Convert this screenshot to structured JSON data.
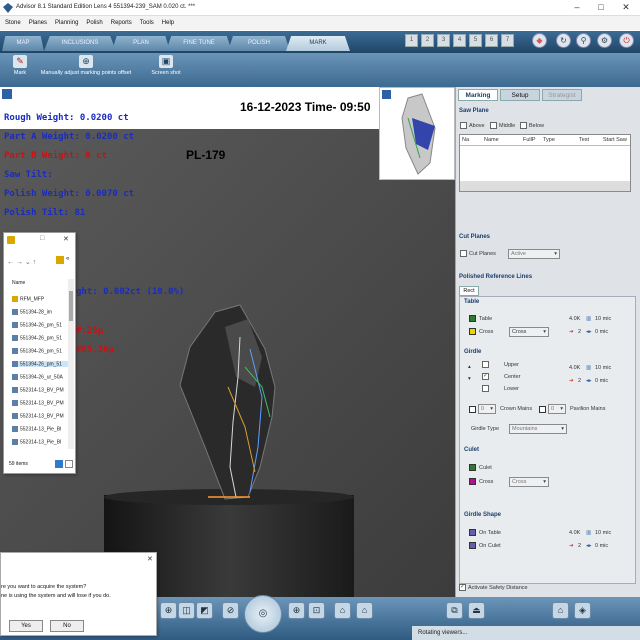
{
  "app": {
    "title": "Advisor 8.1 Standard Edition Lens 4    551394-239_SAM   0.020 ct. ***"
  },
  "menu": [
    "Stone",
    "Planes",
    "Planning",
    "Polish",
    "Reports",
    "Tools",
    "Help"
  ],
  "tabs": [
    {
      "label": "MAP"
    },
    {
      "label": "INCLUSIONS"
    },
    {
      "label": "PLAN"
    },
    {
      "label": "FINE TUNE"
    },
    {
      "label": "POLISH"
    },
    {
      "label": "MARK",
      "active": true
    }
  ],
  "stage_buttons": [
    "1",
    "2",
    "3",
    "4",
    "5",
    "6",
    "7"
  ],
  "toolbar": {
    "mark_label": "Mark",
    "adjust_label": "Manually adjust marking points offset",
    "screenshot_label": "Screen shot"
  },
  "viewer": {
    "datetime": "16-12-2023 Time- 09:50",
    "plabel": "PL-179",
    "lines": [
      {
        "text": "Rough Weight: 0.0200 ct",
        "color": "blue"
      },
      {
        "text": "Part A Weight: 0.0200 ct",
        "color": "blue"
      },
      {
        "text": "Part B Weight: 0 ct",
        "color": "red"
      },
      {
        "text": "Saw Tilt:",
        "color": "blue"
      },
      {
        "text": "Polish Weight: 0.0070 ct",
        "color": "blue"
      },
      {
        "text": "Polish Tilt: 81",
        "color": "blue"
      }
    ],
    "partial1": "ght: 0.002ct (10.0%)",
    "partial2": "#:25µ",
    "partial3": "#65.36µ"
  },
  "explorer": {
    "items": [
      "RFM_MFP",
      "551394-28_im",
      "551394-26_pm_51",
      "551394-26_pm_51",
      "551394-26_pm_51",
      "551394-26_pm_51",
      "551394-26_ur_50A",
      "552314-13_BV_PM",
      "552314-13_BV_PM",
      "552314-13_BV_PM",
      "552314-13_Pie_BI",
      "552314-13_Pie_BI"
    ],
    "name_header": "Name",
    "count": "59 items"
  },
  "dialog": {
    "line1": "re you want to acquire the system?",
    "line2": "ne is using the system and will lose if you do.",
    "yes": "Yes",
    "no": "No"
  },
  "right_panel": {
    "tabs": [
      "Marking",
      "Setup",
      "Strategist"
    ],
    "saw_plane": {
      "title": "Saw Plane",
      "checks": [
        "Above",
        "Middle",
        "Below"
      ],
      "columns": [
        "Na",
        "Name",
        "FullP",
        "Type",
        "Test",
        "Start Saw"
      ]
    },
    "cut_planes": {
      "title": "Cut Planes",
      "check": "Cut Planes",
      "select": "Active"
    },
    "polished": {
      "title": "Polished Reference Lines",
      "subtab": "Rect",
      "table": {
        "title": "Table",
        "table_label": "Table",
        "cross_label": "Cross",
        "cross_select": "Cross",
        "r1": "4.0K",
        "r1b": "10 mic",
        "r2": "2",
        "r2b": "0 mic"
      },
      "girdle": {
        "title": "Girdle",
        "upper": "Upper",
        "center": "Center",
        "lower": "Lower",
        "r1": "4.0K",
        "r1b": "10 mic",
        "r2": "2",
        "r2b": "0 mic",
        "crown_val": "0",
        "crown": "Crown Mains",
        "pav_val": "0",
        "pav": "Pavilion Mains",
        "type_label": "Girdle Type",
        "type_select": "Mountains"
      },
      "culet": {
        "title": "Culet",
        "culet_label": "Culet",
        "cross_label": "Cross",
        "cross_select": "Cross"
      },
      "girdle_shape": {
        "title": "Girdle Shape",
        "on_table": "On Table",
        "on_culet": "On Culet",
        "r1": "4.0K",
        "r1b": "10 mic",
        "r2": "2",
        "r2b": "0 mic"
      }
    }
  },
  "activate": "Activate Safety Distance",
  "status": "Rotating viewers..."
}
